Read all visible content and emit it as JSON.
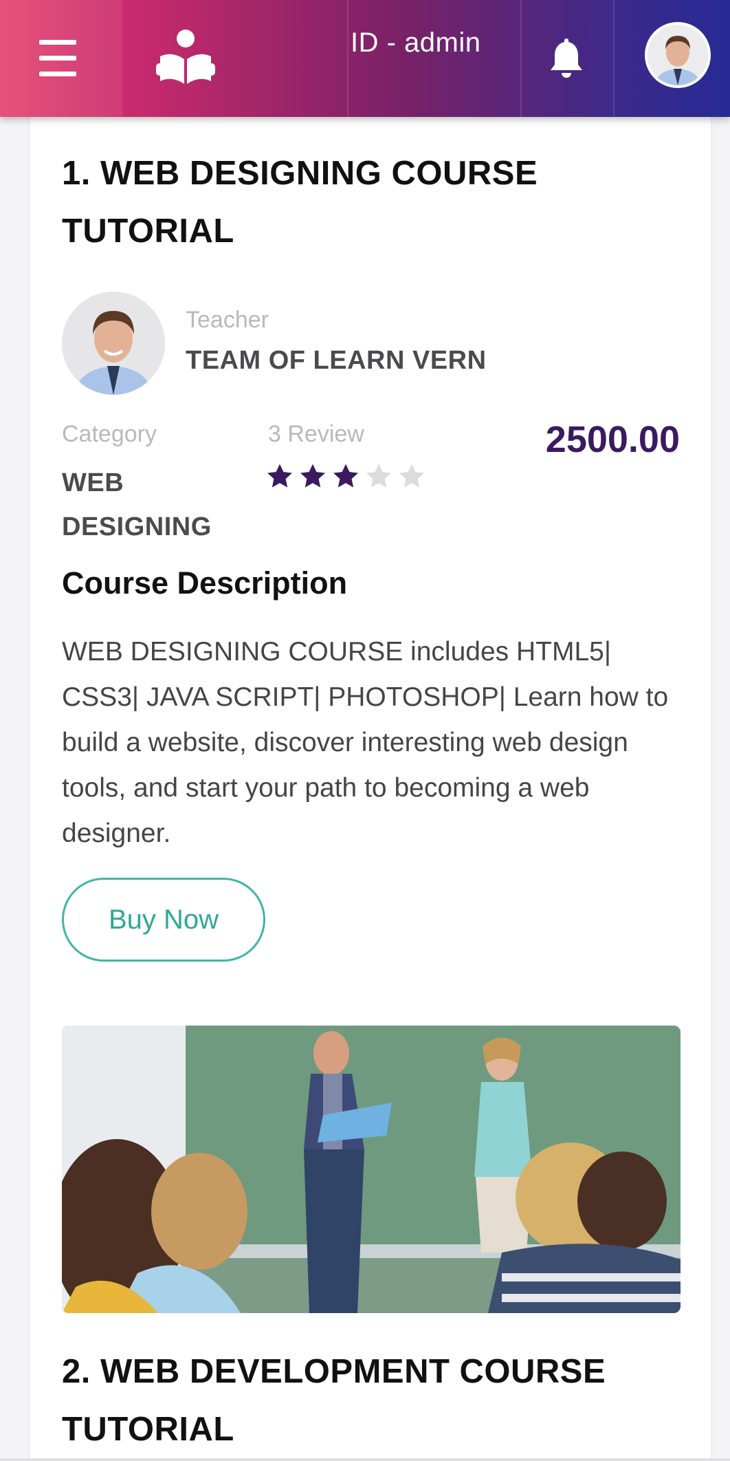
{
  "header": {
    "menu_icon": "hamburger-menu-icon",
    "logo_icon": "reading-person-logo-icon",
    "user_id_text": "ID - admin",
    "bell_icon": "bell-icon",
    "avatar": "user-avatar-photo",
    "gradient_start": "#e5436f",
    "gradient_end": "#272a95"
  },
  "course1": {
    "title_line1": "1. WEB DESIGNING COURSE",
    "title_line2": "TUTORIAL",
    "teacher_label": "Teacher",
    "teacher_name": "TEAM OF LEARN VERN",
    "category_label": "Category",
    "category_line1": "WEB",
    "category_line2": "DESIGNING",
    "review_label": "3 Review",
    "rating": 3,
    "rating_max": 5,
    "price": "2500.00",
    "price_color": "#3b1a60",
    "description_heading": "Course Description",
    "description": "WEB DESIGNING COURSE includes HTML5| CSS3| JAVA SCRIPT| PHOTOSHOP| Learn how to build a website, discover interesting web design tools, and start your path to becoming a web designer.",
    "buy_button": "Buy Now",
    "buy_color": "#3fb6a5"
  },
  "course2": {
    "title_line1": "2. WEB DEVELOPMENT COURSE",
    "title_line2": "TUTORIAL"
  }
}
